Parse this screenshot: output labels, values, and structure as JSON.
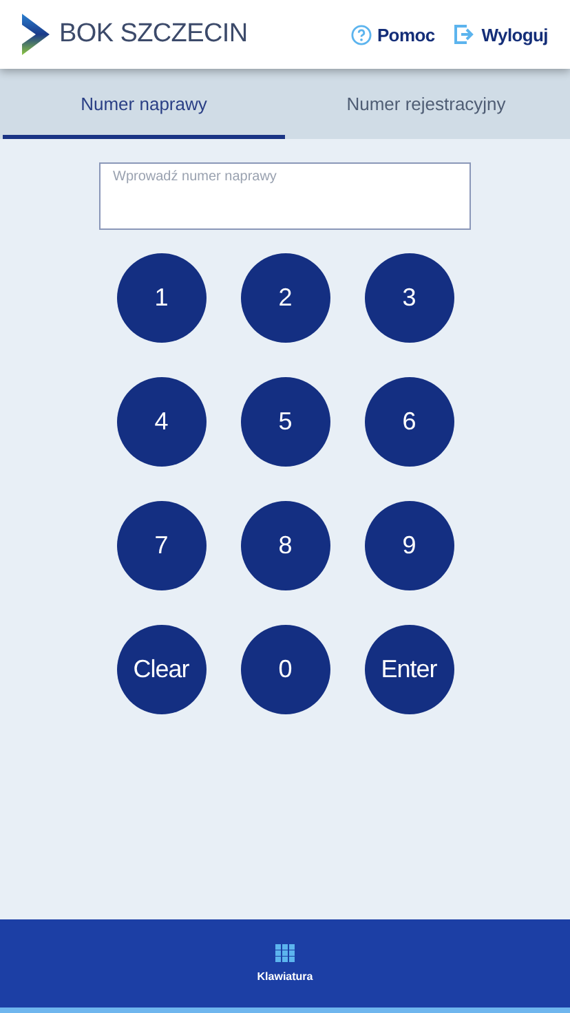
{
  "header": {
    "title": "BOK SZCZECIN",
    "links": [
      "Pomoc",
      "Wyloguj"
    ]
  },
  "tabs": [
    {
      "label": "Numer naprawy",
      "selected": true
    },
    {
      "label": "Numer rejestracyjny",
      "selected": false
    }
  ],
  "field": {
    "placeholder": "Wprowadź numer naprawy"
  },
  "keys": [
    "1",
    "2",
    "3",
    "4",
    "5",
    "6",
    "7",
    "8",
    "9",
    "Clear",
    "0",
    "Enter"
  ],
  "bottom_nav": {
    "label": "Klawiatura"
  }
}
